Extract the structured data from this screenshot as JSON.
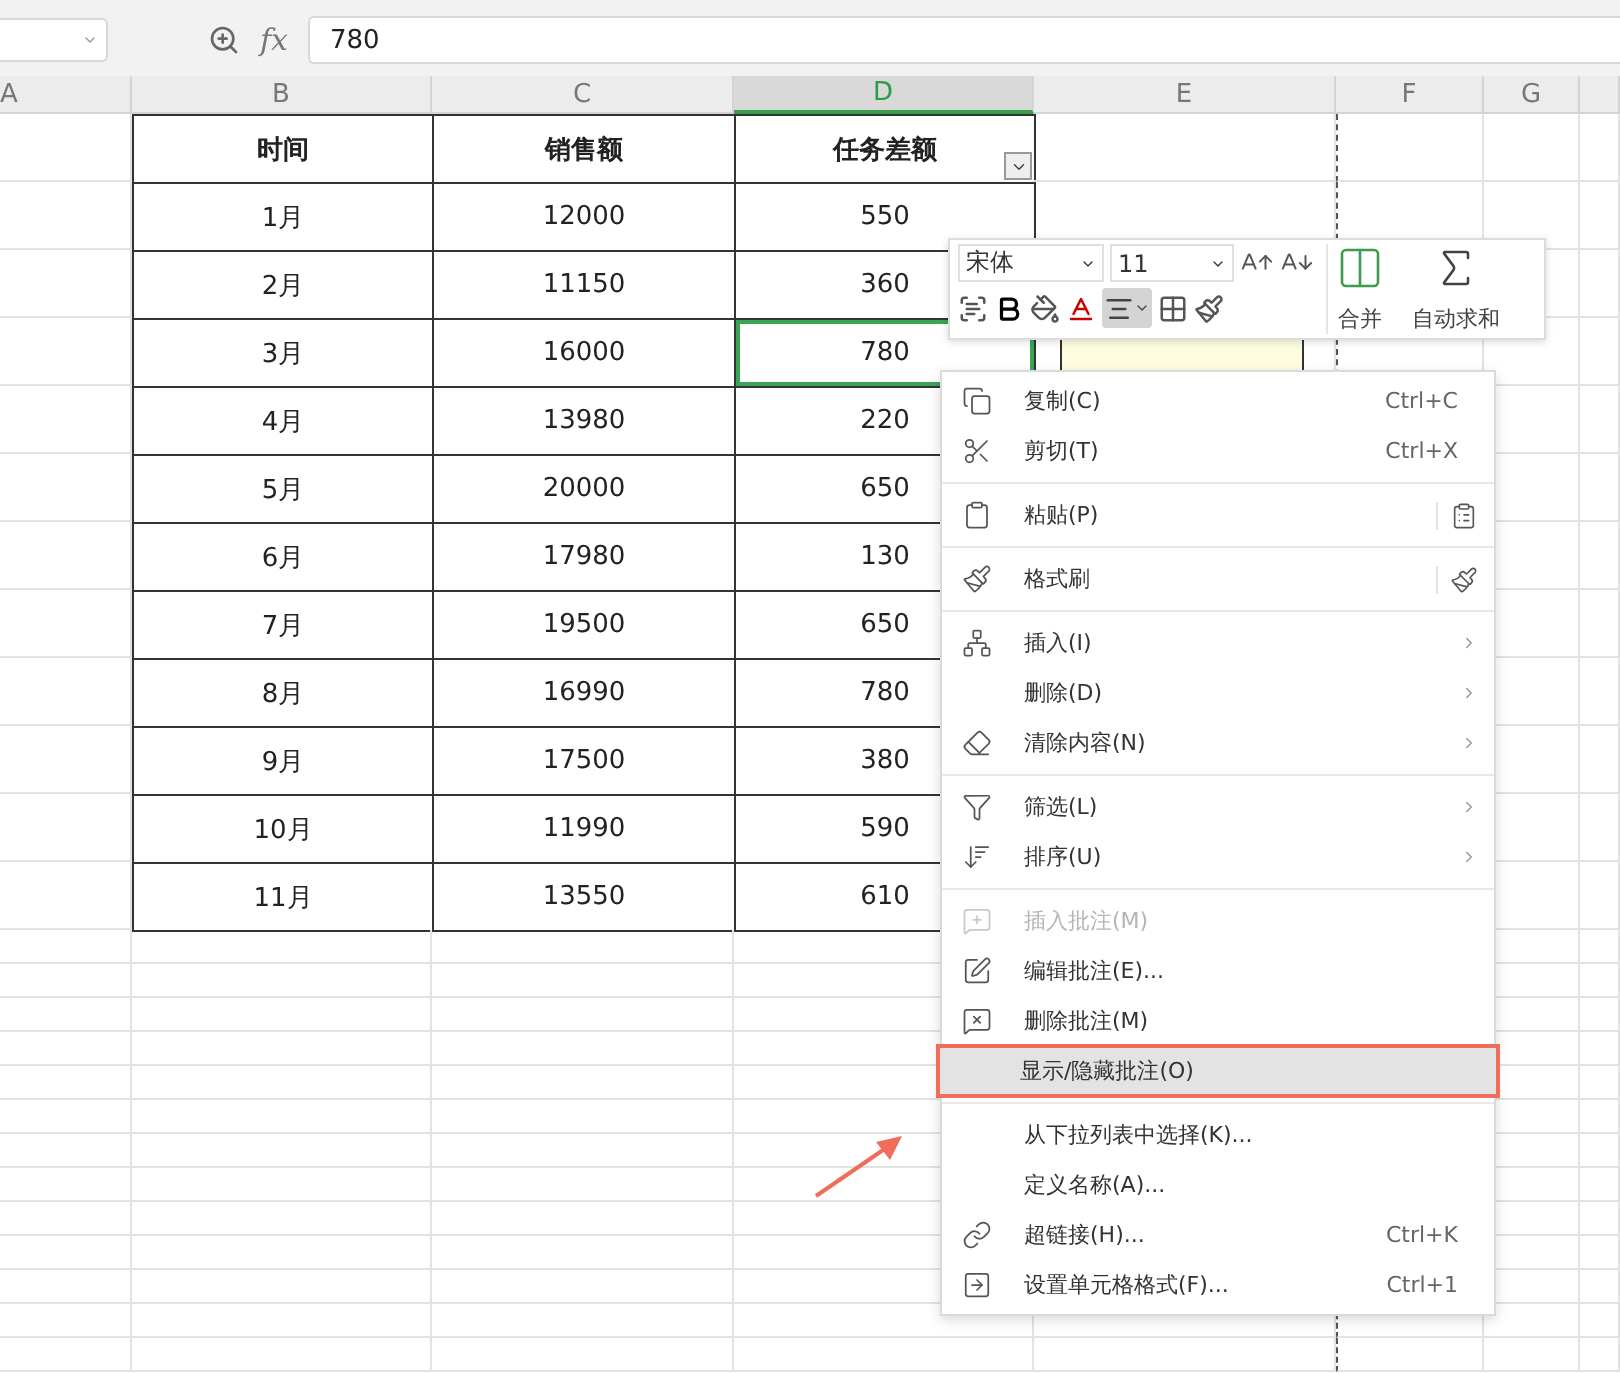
{
  "formula_bar": {
    "function_label": "fx",
    "value": "780"
  },
  "columns": [
    {
      "label": "A",
      "selected": false
    },
    {
      "label": "B",
      "selected": false
    },
    {
      "label": "C",
      "selected": false
    },
    {
      "label": "D",
      "selected": true
    },
    {
      "label": "E",
      "selected": false
    },
    {
      "label": "F",
      "selected": false
    },
    {
      "label": "G",
      "selected": false
    }
  ],
  "table": {
    "headers": [
      "时间",
      "销售额",
      "任务差额"
    ],
    "rows": [
      {
        "cells": [
          "1月",
          "12000",
          "550"
        ],
        "selected": false
      },
      {
        "cells": [
          "2月",
          "11150",
          "360"
        ],
        "selected": false
      },
      {
        "cells": [
          "3月",
          "16000",
          "780"
        ],
        "selected": true
      },
      {
        "cells": [
          "4月",
          "13980",
          "220"
        ],
        "selected": false
      },
      {
        "cells": [
          "5月",
          "20000",
          "650"
        ],
        "selected": false
      },
      {
        "cells": [
          "6月",
          "17980",
          "130"
        ],
        "selected": false
      },
      {
        "cells": [
          "7月",
          "19500",
          "650"
        ],
        "selected": false
      },
      {
        "cells": [
          "8月",
          "16990",
          "780"
        ],
        "selected": false
      },
      {
        "cells": [
          "9月",
          "17500",
          "380"
        ],
        "selected": false
      },
      {
        "cells": [
          "10月",
          "11990",
          "590"
        ],
        "selected": false
      },
      {
        "cells": [
          "11月",
          "13550",
          "610"
        ],
        "selected": false
      }
    ]
  },
  "mini_toolbar": {
    "font": "宋体",
    "size": "11",
    "align_pressed": true,
    "merge_label": "合并",
    "autosum_label": "自动求和"
  },
  "context_menu": [
    {
      "kind": "item",
      "label": "复制(C)",
      "shortcut": "Ctrl+C",
      "disabled": false,
      "highlighted": false,
      "submenu": false,
      "side_button": false
    },
    {
      "kind": "item",
      "label": "剪切(T)",
      "shortcut": "Ctrl+X",
      "disabled": false,
      "highlighted": false,
      "submenu": false,
      "side_button": false
    },
    {
      "kind": "separator"
    },
    {
      "kind": "item",
      "label": "粘贴(P)",
      "disabled": false,
      "highlighted": false,
      "submenu": false,
      "side_button": true
    },
    {
      "kind": "separator"
    },
    {
      "kind": "item",
      "label": "格式刷",
      "disabled": false,
      "highlighted": false,
      "submenu": false,
      "side_button": true
    },
    {
      "kind": "separator"
    },
    {
      "kind": "item",
      "label": "插入(I)",
      "disabled": false,
      "highlighted": false,
      "submenu": true,
      "side_button": false
    },
    {
      "kind": "item",
      "label": "删除(D)",
      "disabled": false,
      "highlighted": false,
      "submenu": true,
      "side_button": false
    },
    {
      "kind": "item",
      "label": "清除内容(N)",
      "disabled": false,
      "highlighted": false,
      "submenu": true,
      "side_button": false
    },
    {
      "kind": "separator"
    },
    {
      "kind": "item",
      "label": "筛选(L)",
      "disabled": false,
      "highlighted": false,
      "submenu": true,
      "side_button": false
    },
    {
      "kind": "item",
      "label": "排序(U)",
      "disabled": false,
      "highlighted": false,
      "submenu": true,
      "side_button": false
    },
    {
      "kind": "separator"
    },
    {
      "kind": "item",
      "label": "插入批注(M)",
      "disabled": true,
      "highlighted": false,
      "submenu": false,
      "side_button": false
    },
    {
      "kind": "item",
      "label": "编辑批注(E)...",
      "disabled": false,
      "highlighted": false,
      "submenu": false,
      "side_button": false
    },
    {
      "kind": "item",
      "label": "删除批注(M)",
      "disabled": false,
      "highlighted": false,
      "submenu": false,
      "side_button": false
    },
    {
      "kind": "item",
      "label": "显示/隐藏批注(O)",
      "disabled": false,
      "highlighted": true,
      "submenu": false,
      "side_button": false
    },
    {
      "kind": "separator"
    },
    {
      "kind": "item",
      "label": "从下拉列表中选择(K)...",
      "disabled": false,
      "highlighted": false,
      "submenu": false,
      "side_button": false
    },
    {
      "kind": "item",
      "label": "定义名称(A)...",
      "disabled": false,
      "highlighted": false,
      "submenu": false,
      "side_button": false
    },
    {
      "kind": "item",
      "label": "超链接(H)...",
      "shortcut": "Ctrl+K",
      "disabled": false,
      "highlighted": false,
      "submenu": false,
      "side_button": false
    },
    {
      "kind": "item",
      "label": "设置单元格格式(F)...",
      "shortcut": "Ctrl+1",
      "disabled": false,
      "highlighted": false,
      "submenu": false,
      "side_button": false
    }
  ]
}
